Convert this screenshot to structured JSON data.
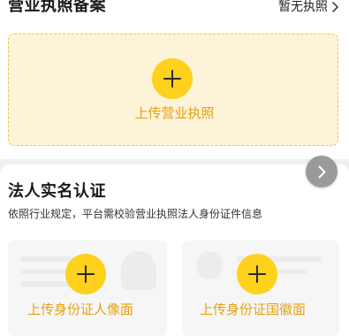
{
  "business_license": {
    "title": "营业执照备案",
    "no_license_label": "暂无执照",
    "upload_label": "上传营业执照"
  },
  "legal_person": {
    "title": "法人实名认证",
    "description": "依照行业规定，平台需校验营业执照法人身份证件信息",
    "id_front_label": "上传身份证人像面",
    "id_back_label": "上传身份证国徽面"
  },
  "colors": {
    "accent_yellow": "#fdd11c",
    "label_orange": "#e5a012",
    "dashed_border": "#f1c34a",
    "upload_bg": "#fdf3d9",
    "arrow_button": "#9a9a9a"
  },
  "icons": {
    "plus": "plus-icon",
    "chevron_right": "chevron-right-icon"
  }
}
